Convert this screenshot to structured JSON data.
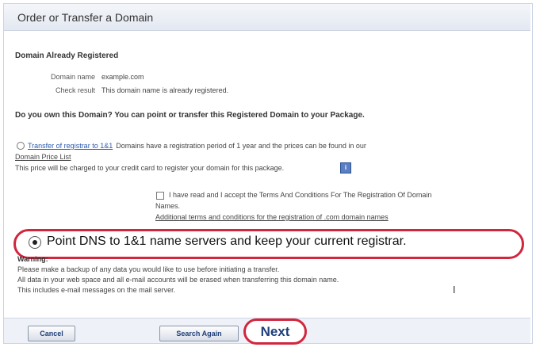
{
  "title": "Order or Transfer a Domain",
  "section": {
    "title": "Domain Already Registered",
    "domain_name_label": "Domain name",
    "domain_name_value": "example.com",
    "check_result_label": "Check result",
    "check_result_value": "This domain name is already registered."
  },
  "question": "Do you own this Domain? You can point or transfer this Registered Domain to your Package.",
  "transfer_option": {
    "label": "Transfer of registrar to 1&1",
    "description": "Domains have a registration period of 1 year and the prices can be found in our",
    "price_list_link": "Domain Price List",
    "charge_note": "This price will be charged to your credit card to register your domain for this package."
  },
  "terms": {
    "checkbox_label_line1": "I have read and I accept the Terms And Conditions For The Registration Of Domain",
    "checkbox_label_line2": "Names.",
    "additional_link": "Additional terms and conditions for the registration of .com domain names"
  },
  "dns_option": {
    "label": "Point DNS to 1&1 name servers and keep your current registrar."
  },
  "warning": {
    "title": "Warning:",
    "lines": [
      "Please make a backup of any data you would like to use before initiating a transfer.",
      "All data in your web space and all e-mail accounts will be erased when transferring this domain name.",
      "This includes e-mail messages on the mail server."
    ]
  },
  "buttons": {
    "cancel": "Cancel",
    "search_again": "Search Again",
    "next": "Next"
  }
}
